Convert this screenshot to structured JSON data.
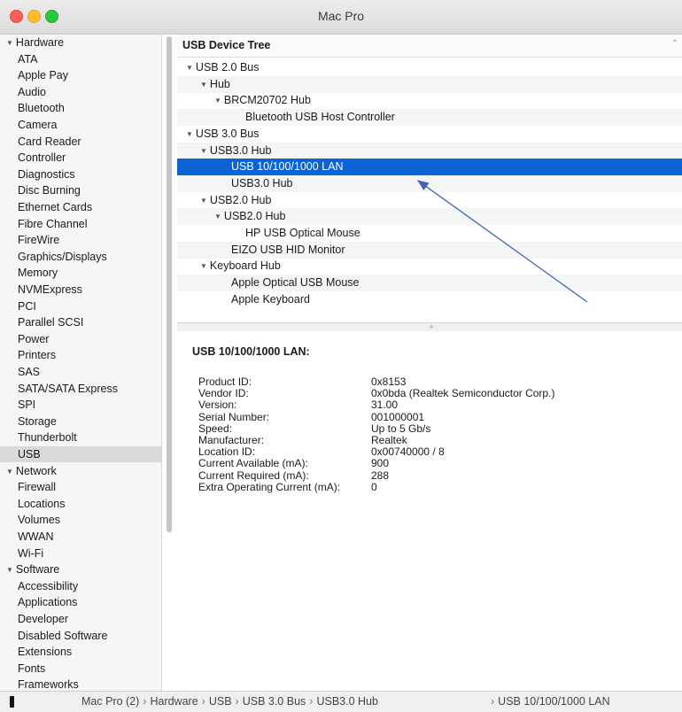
{
  "window": {
    "title": "Mac Pro"
  },
  "sidebar": {
    "groups": [
      {
        "label": "Hardware",
        "items": [
          "ATA",
          "Apple Pay",
          "Audio",
          "Bluetooth",
          "Camera",
          "Card Reader",
          "Controller",
          "Diagnostics",
          "Disc Burning",
          "Ethernet Cards",
          "Fibre Channel",
          "FireWire",
          "Graphics/Displays",
          "Memory",
          "NVMExpress",
          "PCI",
          "Parallel SCSI",
          "Power",
          "Printers",
          "SAS",
          "SATA/SATA Express",
          "SPI",
          "Storage",
          "Thunderbolt",
          "USB"
        ]
      },
      {
        "label": "Network",
        "items": [
          "Firewall",
          "Locations",
          "Volumes",
          "WWAN",
          "Wi-Fi"
        ]
      },
      {
        "label": "Software",
        "items": [
          "Accessibility",
          "Applications",
          "Developer",
          "Disabled Software",
          "Extensions",
          "Fonts",
          "Frameworks"
        ]
      }
    ],
    "selected": "USB"
  },
  "tree": {
    "header": "USB Device Tree",
    "rows": [
      {
        "label": "USB 2.0 Bus",
        "expanded": true
      },
      {
        "label": "Hub",
        "expanded": true
      },
      {
        "label": "BRCM20702 Hub",
        "expanded": true
      },
      {
        "label": "Bluetooth USB Host Controller",
        "expanded": false
      },
      {
        "label": "USB 3.0 Bus",
        "expanded": true
      },
      {
        "label": "USB3.0 Hub",
        "expanded": true
      },
      {
        "label": "USB 10/100/1000 LAN",
        "expanded": false,
        "selected": true
      },
      {
        "label": "USB3.0 Hub",
        "expanded": false
      },
      {
        "label": "USB2.0 Hub",
        "expanded": true
      },
      {
        "label": "USB2.0 Hub",
        "expanded": true
      },
      {
        "label": "HP USB Optical Mouse",
        "expanded": false
      },
      {
        "label": "EIZO USB HID Monitor",
        "expanded": false
      },
      {
        "label": "Keyboard Hub",
        "expanded": true
      },
      {
        "label": "Apple Optical USB Mouse",
        "expanded": false
      },
      {
        "label": "Apple Keyboard",
        "expanded": false
      }
    ]
  },
  "detail": {
    "title": "USB 10/100/1000 LAN:",
    "properties": [
      {
        "label": "Product ID:",
        "value": "0x8153"
      },
      {
        "label": "Vendor ID:",
        "value": "0x0bda  (Realtek Semiconductor Corp.)"
      },
      {
        "label": "Version:",
        "value": "31.00"
      },
      {
        "label": "Serial Number:",
        "value": "001000001"
      },
      {
        "label": "Speed:",
        "value": "Up to 5 Gb/s"
      },
      {
        "label": "Manufacturer:",
        "value": "Realtek"
      },
      {
        "label": "Location ID:",
        "value": "0x00740000 / 8"
      },
      {
        "label": "Current Available (mA):",
        "value": "900"
      },
      {
        "label": "Current Required (mA):",
        "value": "288"
      },
      {
        "label": "Extra Operating Current (mA):",
        "value": "0"
      }
    ]
  },
  "statusbar": {
    "path": [
      "Mac Pro (2)",
      "Hardware",
      "USB",
      "USB 3.0 Bus",
      "USB3.0 Hub"
    ],
    "last": "USB 10/100/1000 LAN"
  },
  "colors": {
    "selection": "#0b63d6",
    "annotation_arrow": "#3f64b5"
  }
}
